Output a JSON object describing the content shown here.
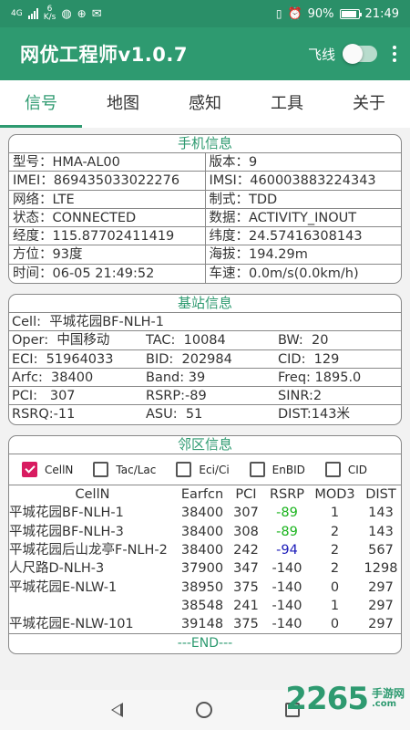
{
  "status_bar": {
    "network_type": "4G",
    "net_speed_value": "6",
    "net_speed_unit": "K/s",
    "battery": "90%",
    "battery_level": 0.9,
    "time": "21:49",
    "left_icons": [
      "signal-icon",
      "speed-icon",
      "wechat-icon",
      "gps-icon",
      "mail-icon"
    ],
    "right_icons": [
      "vibrate-icon",
      "alarm-icon",
      "wifi-icon",
      "battery-icon"
    ]
  },
  "app_bar": {
    "title": "网优工程师v1.0.7",
    "flight_label": "飞线",
    "flight_on": false
  },
  "tabs": [
    {
      "label": "信号",
      "active": true
    },
    {
      "label": "地图",
      "active": false
    },
    {
      "label": "感知",
      "active": false
    },
    {
      "label": "工具",
      "active": false
    },
    {
      "label": "关于",
      "active": false
    }
  ],
  "phone_info": {
    "title": "手机信息",
    "rows": [
      [
        "型号：HMA-AL00",
        "版本：9"
      ],
      [
        "IMEI：869435033022276",
        "IMSI：460003883224343"
      ],
      [
        "网络：LTE",
        "制式：TDD"
      ],
      [
        "状态：CONNECTED",
        "数据：ACTIVITY_INOUT"
      ],
      [
        "经度：115.87702411419",
        "纬度：24.57416308143"
      ],
      [
        "方位：93度",
        "海拔：194.29m"
      ],
      [
        "时间：06-05 21:49:52",
        "车速：0.0m/s(0.0km/h)"
      ]
    ]
  },
  "base_station": {
    "title": "基站信息",
    "cell": "Cell:  平城花园BF-NLH-1",
    "rows": [
      [
        "Oper:  中国移动",
        "TAC:  10084",
        "BW:  20"
      ],
      [
        "ECI:  51964033",
        "BID:  202984",
        "CID:  129"
      ],
      [
        "Arfc:  38400",
        "Band: 39",
        "Freq: 1895.0"
      ],
      [
        "PCI:   307",
        "RSRP:-89",
        "SINR:2"
      ],
      [
        "RSRQ:-11",
        "ASU:  51",
        "DIST:143米"
      ]
    ]
  },
  "neighbor": {
    "title": "邻区信息",
    "filters": [
      {
        "label": "CellN",
        "checked": true
      },
      {
        "label": "Tac/Lac",
        "checked": false
      },
      {
        "label": "Eci/Ci",
        "checked": false
      },
      {
        "label": "EnBID",
        "checked": false
      },
      {
        "label": "CID",
        "checked": false
      }
    ],
    "columns": [
      "CellN",
      "Earfcn",
      "PCI",
      "RSRP",
      "MOD3",
      "DIST"
    ],
    "rows": [
      {
        "cells": [
          "平城花园BF-NLH-1",
          "38400",
          "307",
          "-89",
          "1",
          "143"
        ],
        "rsrp_color": "green"
      },
      {
        "cells": [
          "平城花园BF-NLH-3",
          "38400",
          "308",
          "-89",
          "2",
          "143"
        ],
        "rsrp_color": "green"
      },
      {
        "cells": [
          "平城花园后山龙亭F-NLH-2",
          "38400",
          "242",
          "-94",
          "2",
          "567"
        ],
        "rsrp_color": "blue"
      },
      {
        "cells": [
          "人尺路D-NLH-3",
          "37900",
          "347",
          "-140",
          "2",
          "1298"
        ],
        "rsrp_color": "normal"
      },
      {
        "cells": [
          "平城花园E-NLW-1",
          "38950",
          "375",
          "-140",
          "0",
          "297"
        ],
        "rsrp_color": "normal"
      },
      {
        "cells": [
          "",
          "38548",
          "241",
          "-140",
          "1",
          "297"
        ],
        "rsrp_color": "normal"
      },
      {
        "cells": [
          "平城花园E-NLW-101",
          "39148",
          "375",
          "-140",
          "0",
          "297"
        ],
        "rsrp_color": "normal"
      }
    ],
    "end_label": "---END---"
  },
  "watermark": {
    "number": "2265",
    "suffix": ".com",
    "sub": "手游网"
  },
  "colors": {
    "primary": "#2e9a70",
    "status_bar": "#2a8f68",
    "checkbox": "#d81b60",
    "rsrp_green": "#19b31c",
    "rsrp_blue": "#1a1ab8"
  }
}
